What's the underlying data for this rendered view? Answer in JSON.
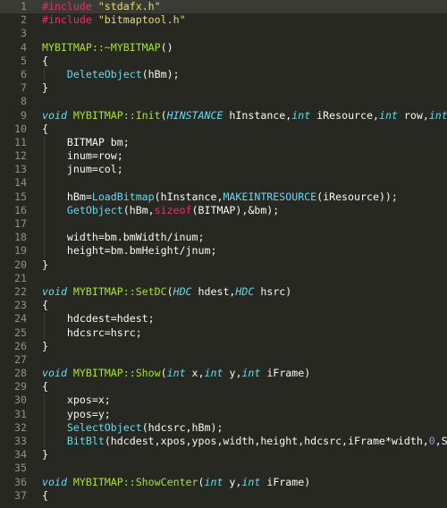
{
  "editor": {
    "theme_colors": {
      "background": "#272822",
      "current_line": "#3a3b35",
      "gutter_text": "#8f908a",
      "preprocessor": "#f92672",
      "string": "#e6db74",
      "class_name": "#a6e22e",
      "function": "#66d9ef",
      "keyword": "#66d9ef",
      "number": "#ae81ff",
      "text": "#f8f8f2"
    },
    "current_line": 1,
    "lines": [
      {
        "n": "1",
        "indent": false,
        "tokens": [
          {
            "c": "t-pp",
            "t": "#include"
          },
          {
            "c": "t-plain",
            "t": " "
          },
          {
            "c": "t-str",
            "t": "\"stdafx.h\""
          }
        ]
      },
      {
        "n": "2",
        "indent": false,
        "tokens": [
          {
            "c": "t-pp",
            "t": "#include"
          },
          {
            "c": "t-plain",
            "t": " "
          },
          {
            "c": "t-str",
            "t": "\"bitmaptool.h\""
          }
        ]
      },
      {
        "n": "3",
        "indent": false,
        "tokens": []
      },
      {
        "n": "4",
        "indent": false,
        "tokens": [
          {
            "c": "t-cls",
            "t": "MYBITMAP::~MYBITMAP"
          },
          {
            "c": "t-plain",
            "t": "()"
          }
        ]
      },
      {
        "n": "5",
        "indent": false,
        "tokens": [
          {
            "c": "t-plain",
            "t": "{"
          }
        ]
      },
      {
        "n": "6",
        "indent": true,
        "tokens": [
          {
            "c": "t-plain",
            "t": "    "
          },
          {
            "c": "t-fn",
            "t": "DeleteObject"
          },
          {
            "c": "t-plain",
            "t": "(hBm);"
          }
        ]
      },
      {
        "n": "7",
        "indent": false,
        "tokens": [
          {
            "c": "t-plain",
            "t": "}"
          }
        ]
      },
      {
        "n": "8",
        "indent": false,
        "tokens": []
      },
      {
        "n": "9",
        "indent": false,
        "tokens": [
          {
            "c": "t-kw",
            "t": "void"
          },
          {
            "c": "t-plain",
            "t": " "
          },
          {
            "c": "t-cls",
            "t": "MYBITMAP::Init"
          },
          {
            "c": "t-plain",
            "t": "("
          },
          {
            "c": "t-type",
            "t": "HINSTANCE"
          },
          {
            "c": "t-plain",
            "t": " hInstance,"
          },
          {
            "c": "t-type",
            "t": "int"
          },
          {
            "c": "t-plain",
            "t": " iResource,"
          },
          {
            "c": "t-type",
            "t": "int"
          },
          {
            "c": "t-plain",
            "t": " row,"
          },
          {
            "c": "t-type",
            "t": "int"
          }
        ]
      },
      {
        "n": "10",
        "indent": false,
        "tokens": [
          {
            "c": "t-plain",
            "t": "{"
          }
        ]
      },
      {
        "n": "11",
        "indent": true,
        "tokens": [
          {
            "c": "t-plain",
            "t": "    BITMAP bm;"
          }
        ]
      },
      {
        "n": "12",
        "indent": true,
        "tokens": [
          {
            "c": "t-plain",
            "t": "    inum=row;"
          }
        ]
      },
      {
        "n": "13",
        "indent": true,
        "tokens": [
          {
            "c": "t-plain",
            "t": "    jnum=col;"
          }
        ]
      },
      {
        "n": "14",
        "indent": true,
        "tokens": []
      },
      {
        "n": "15",
        "indent": true,
        "tokens": [
          {
            "c": "t-plain",
            "t": "    hBm="
          },
          {
            "c": "t-fn",
            "t": "LoadBitmap"
          },
          {
            "c": "t-plain",
            "t": "(hInstance,"
          },
          {
            "c": "t-fn",
            "t": "MAKEINTRESOURCE"
          },
          {
            "c": "t-plain",
            "t": "(iResource));"
          }
        ]
      },
      {
        "n": "16",
        "indent": true,
        "tokens": [
          {
            "c": "t-plain",
            "t": "    "
          },
          {
            "c": "t-fn",
            "t": "GetObject"
          },
          {
            "c": "t-plain",
            "t": "(hBm,"
          },
          {
            "c": "t-op",
            "t": "sizeof"
          },
          {
            "c": "t-plain",
            "t": "(BITMAP),&bm);"
          }
        ]
      },
      {
        "n": "17",
        "indent": true,
        "tokens": []
      },
      {
        "n": "18",
        "indent": true,
        "tokens": [
          {
            "c": "t-plain",
            "t": "    width=bm.bmWidth/inum;"
          }
        ]
      },
      {
        "n": "19",
        "indent": true,
        "tokens": [
          {
            "c": "t-plain",
            "t": "    height=bm.bmHeight/jnum;"
          }
        ]
      },
      {
        "n": "20",
        "indent": false,
        "tokens": [
          {
            "c": "t-plain",
            "t": "}"
          }
        ]
      },
      {
        "n": "21",
        "indent": false,
        "tokens": []
      },
      {
        "n": "22",
        "indent": false,
        "tokens": [
          {
            "c": "t-kw",
            "t": "void"
          },
          {
            "c": "t-plain",
            "t": " "
          },
          {
            "c": "t-cls",
            "t": "MYBITMAP::SetDC"
          },
          {
            "c": "t-plain",
            "t": "("
          },
          {
            "c": "t-type",
            "t": "HDC"
          },
          {
            "c": "t-plain",
            "t": " hdest,"
          },
          {
            "c": "t-type",
            "t": "HDC"
          },
          {
            "c": "t-plain",
            "t": " hsrc)"
          }
        ]
      },
      {
        "n": "23",
        "indent": false,
        "tokens": [
          {
            "c": "t-plain",
            "t": "{"
          }
        ]
      },
      {
        "n": "24",
        "indent": true,
        "tokens": [
          {
            "c": "t-plain",
            "t": "    hdcdest=hdest;"
          }
        ]
      },
      {
        "n": "25",
        "indent": true,
        "tokens": [
          {
            "c": "t-plain",
            "t": "    hdcsrc=hsrc;"
          }
        ]
      },
      {
        "n": "26",
        "indent": false,
        "tokens": [
          {
            "c": "t-plain",
            "t": "}"
          }
        ]
      },
      {
        "n": "27",
        "indent": false,
        "tokens": []
      },
      {
        "n": "28",
        "indent": false,
        "tokens": [
          {
            "c": "t-kw",
            "t": "void"
          },
          {
            "c": "t-plain",
            "t": " "
          },
          {
            "c": "t-cls",
            "t": "MYBITMAP::Show"
          },
          {
            "c": "t-plain",
            "t": "("
          },
          {
            "c": "t-type",
            "t": "int"
          },
          {
            "c": "t-plain",
            "t": " x,"
          },
          {
            "c": "t-type",
            "t": "int"
          },
          {
            "c": "t-plain",
            "t": " y,"
          },
          {
            "c": "t-type",
            "t": "int"
          },
          {
            "c": "t-plain",
            "t": " iFrame)"
          }
        ]
      },
      {
        "n": "29",
        "indent": false,
        "tokens": [
          {
            "c": "t-plain",
            "t": "{"
          }
        ]
      },
      {
        "n": "30",
        "indent": true,
        "tokens": [
          {
            "c": "t-plain",
            "t": "    xpos=x;"
          }
        ]
      },
      {
        "n": "31",
        "indent": true,
        "tokens": [
          {
            "c": "t-plain",
            "t": "    ypos=y;"
          }
        ]
      },
      {
        "n": "32",
        "indent": true,
        "tokens": [
          {
            "c": "t-plain",
            "t": "    "
          },
          {
            "c": "t-fn",
            "t": "SelectObject"
          },
          {
            "c": "t-plain",
            "t": "(hdcsrc,hBm);"
          }
        ]
      },
      {
        "n": "33",
        "indent": true,
        "tokens": [
          {
            "c": "t-plain",
            "t": "    "
          },
          {
            "c": "t-fn",
            "t": "BitBlt"
          },
          {
            "c": "t-plain",
            "t": "(hdcdest,xpos,ypos,width,height,hdcsrc,iFrame*width,"
          },
          {
            "c": "t-num",
            "t": "0"
          },
          {
            "c": "t-plain",
            "t": ",S"
          }
        ]
      },
      {
        "n": "34",
        "indent": false,
        "tokens": [
          {
            "c": "t-plain",
            "t": "}"
          }
        ]
      },
      {
        "n": "35",
        "indent": false,
        "tokens": []
      },
      {
        "n": "36",
        "indent": false,
        "tokens": [
          {
            "c": "t-kw",
            "t": "void"
          },
          {
            "c": "t-plain",
            "t": " "
          },
          {
            "c": "t-cls",
            "t": "MYBITMAP::ShowCenter"
          },
          {
            "c": "t-plain",
            "t": "("
          },
          {
            "c": "t-type",
            "t": "int"
          },
          {
            "c": "t-plain",
            "t": " y,"
          },
          {
            "c": "t-type",
            "t": "int"
          },
          {
            "c": "t-plain",
            "t": " iFrame)"
          }
        ]
      },
      {
        "n": "37",
        "indent": false,
        "tokens": [
          {
            "c": "t-plain",
            "t": "{"
          }
        ]
      }
    ]
  }
}
